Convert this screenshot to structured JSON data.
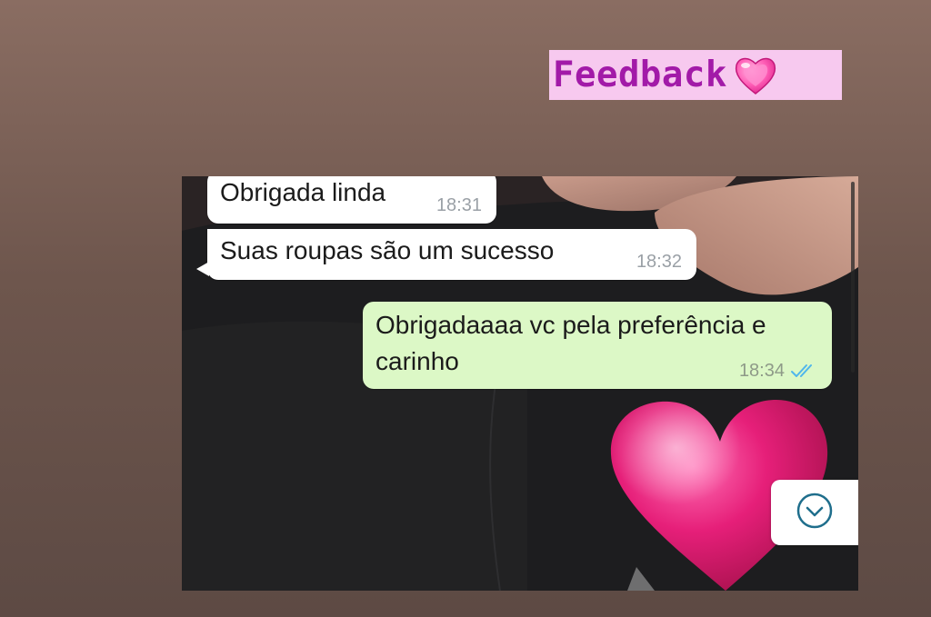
{
  "sticker": {
    "label": "Feedback",
    "heart_icon": "sparkling-heart-emoji",
    "background_color": "#f7c9ef",
    "text_color": "#a21aa8"
  },
  "chat": {
    "messages": [
      {
        "direction": "incoming",
        "text": "Obrigada linda",
        "time": "18:31"
      },
      {
        "direction": "incoming",
        "text": "Suas roupas são um sucesso",
        "time": "18:32"
      },
      {
        "direction": "outgoing",
        "text": "Obrigadaaaa vc pela preferência e\ncarinho",
        "time": "18:34",
        "status_icon": "double-check-read-icon"
      }
    ],
    "incoming_bubble_color": "#ffffff",
    "outgoing_bubble_color": "#dcf8c6",
    "read_tick_color": "#4fb6ec",
    "scroll_button_icon": "chevron-down-circle-icon"
  },
  "overlay": {
    "sticker_icon": "pink-heart-sticker"
  }
}
